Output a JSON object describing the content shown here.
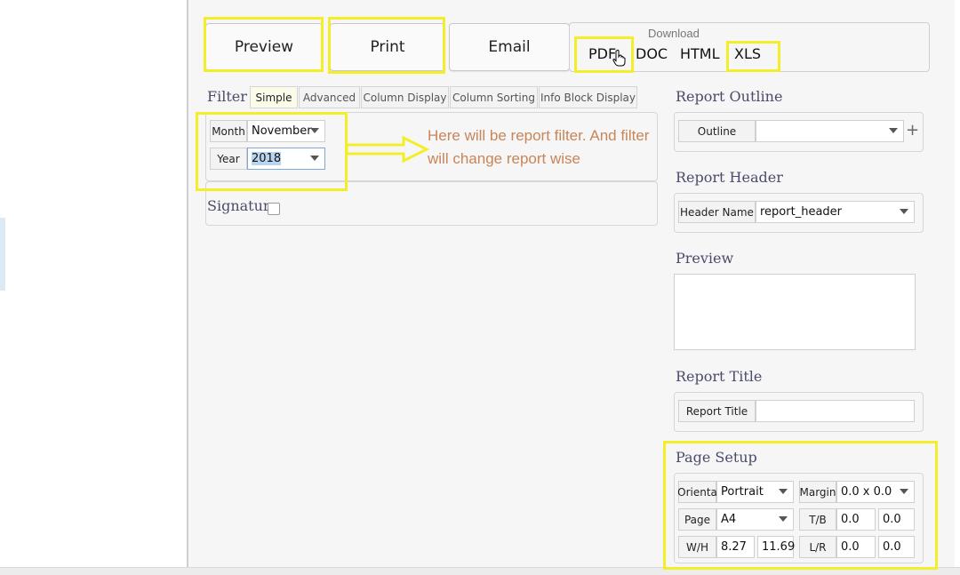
{
  "toolbar": {
    "preview_label": "Preview",
    "print_label": "Print",
    "email_label": "Email",
    "download": {
      "title": "Download",
      "options": [
        "PDF",
        "DOC",
        "HTML",
        "XLS"
      ]
    }
  },
  "filter": {
    "title": "Filter",
    "tabs": [
      {
        "label": "Simple",
        "active": true
      },
      {
        "label": "Advanced",
        "active": false
      },
      {
        "label": "Column Display",
        "active": false
      },
      {
        "label": "Column Sorting",
        "active": false
      },
      {
        "label": "Info Block Display",
        "active": false
      }
    ],
    "fields": {
      "month": {
        "label": "Month",
        "value": "November"
      },
      "year": {
        "label": "Year",
        "value": "2018"
      }
    },
    "signature_label": "Signature",
    "signature_checked": false
  },
  "annotation": {
    "text": "Here will be report filter. And filter will change report wise",
    "color": "#c88558"
  },
  "highlight_color": "#f4ee2a",
  "outline": {
    "title": "Report Outline",
    "label": "Outline",
    "value": "",
    "add_symbol": "+"
  },
  "report_header": {
    "title": "Report Header",
    "label": "Header Name",
    "value": "report_header"
  },
  "preview": {
    "title": "Preview"
  },
  "report_title": {
    "title": "Report Title",
    "label": "Report Title",
    "value": ""
  },
  "page_setup": {
    "title": "Page Setup",
    "orientation": {
      "label": "Orienta",
      "value": "Portrait"
    },
    "margin": {
      "label": "Margin",
      "value": "0.0 x 0.0"
    },
    "page": {
      "label": "Page",
      "value": "A4"
    },
    "tb": {
      "label": "T/B",
      "value1": "0.0",
      "value2": "0.0"
    },
    "wh": {
      "label": "W/H",
      "value1": "8.27",
      "value2": "11.69"
    },
    "lr": {
      "label": "L/R",
      "value1": "0.0",
      "value2": "0.0"
    }
  }
}
